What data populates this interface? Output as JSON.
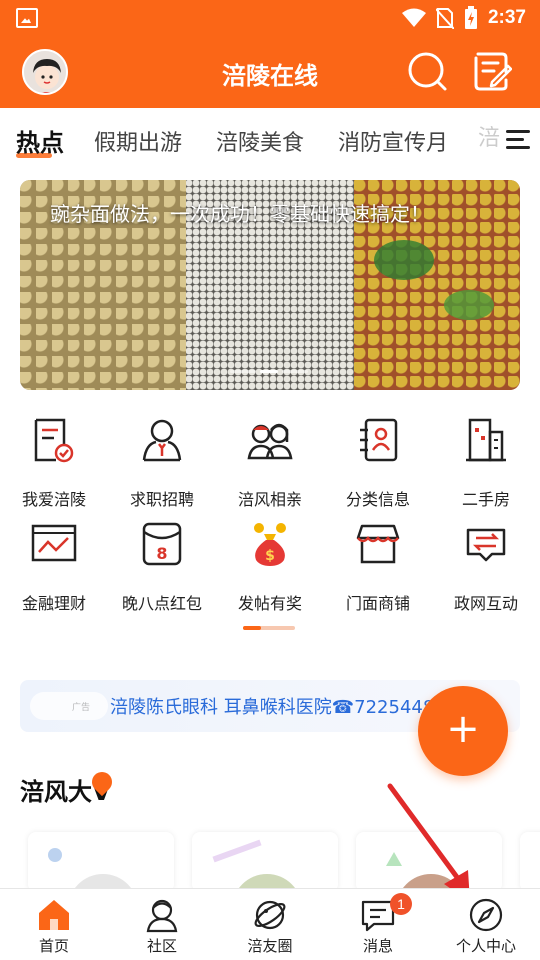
{
  "status_bar": {
    "time": "2:37",
    "icons": [
      "image-icon",
      "wifi-icon",
      "no-sim-icon",
      "battery-charging-icon"
    ]
  },
  "header": {
    "title": "涪陵在线",
    "avatar_icon": "avatar",
    "search_icon": "search-icon",
    "edit_icon": "edit-icon"
  },
  "tabs": {
    "items": [
      "热点",
      "假期出游",
      "涪陵美食",
      "消防宣传月"
    ],
    "overflow_text": "涪",
    "active_index": 0,
    "menu_icon": "menu-icon"
  },
  "banner": {
    "title": "豌杂面做法，一次成功！零基础快速搞定！",
    "slide_count": 3,
    "active_slide": 1
  },
  "grid": {
    "items": [
      {
        "label": "我爱涪陵",
        "icon": "document-check-icon"
      },
      {
        "label": "求职招聘",
        "icon": "person-tie-icon"
      },
      {
        "label": "涪风相亲",
        "icon": "couple-icon"
      },
      {
        "label": "分类信息",
        "icon": "contact-list-icon"
      },
      {
        "label": "二手房",
        "icon": "building-icon"
      },
      {
        "label": "金融理财",
        "icon": "chart-icon"
      },
      {
        "label": "晚八点红包",
        "icon": "red-envelope-icon"
      },
      {
        "label": "发帖有奖",
        "icon": "money-bag-icon"
      },
      {
        "label": "门面商铺",
        "icon": "shop-icon"
      },
      {
        "label": "政网互动",
        "icon": "exchange-icon"
      }
    ],
    "page": 1,
    "page_count": 2
  },
  "ad": {
    "tag": "广告",
    "text": "涪陵陈氏眼科 耳鼻喉科医院☎72254488"
  },
  "fab": {
    "label": "+"
  },
  "section": {
    "title": "涪风大V"
  },
  "bottom_nav": {
    "items": [
      {
        "label": "首页",
        "icon": "home-icon",
        "active": true
      },
      {
        "label": "社区",
        "icon": "community-icon"
      },
      {
        "label": "涪友圈",
        "icon": "planet-icon"
      },
      {
        "label": "消息",
        "icon": "message-icon",
        "badge": "1"
      },
      {
        "label": "个人中心",
        "icon": "compass-icon"
      }
    ]
  },
  "colors": {
    "brand": "#fb6617",
    "ad_text": "#2a6bd9",
    "badge": "#f0522a",
    "icon_red": "#d9352a",
    "annotation_arrow": "#e02a2a"
  }
}
